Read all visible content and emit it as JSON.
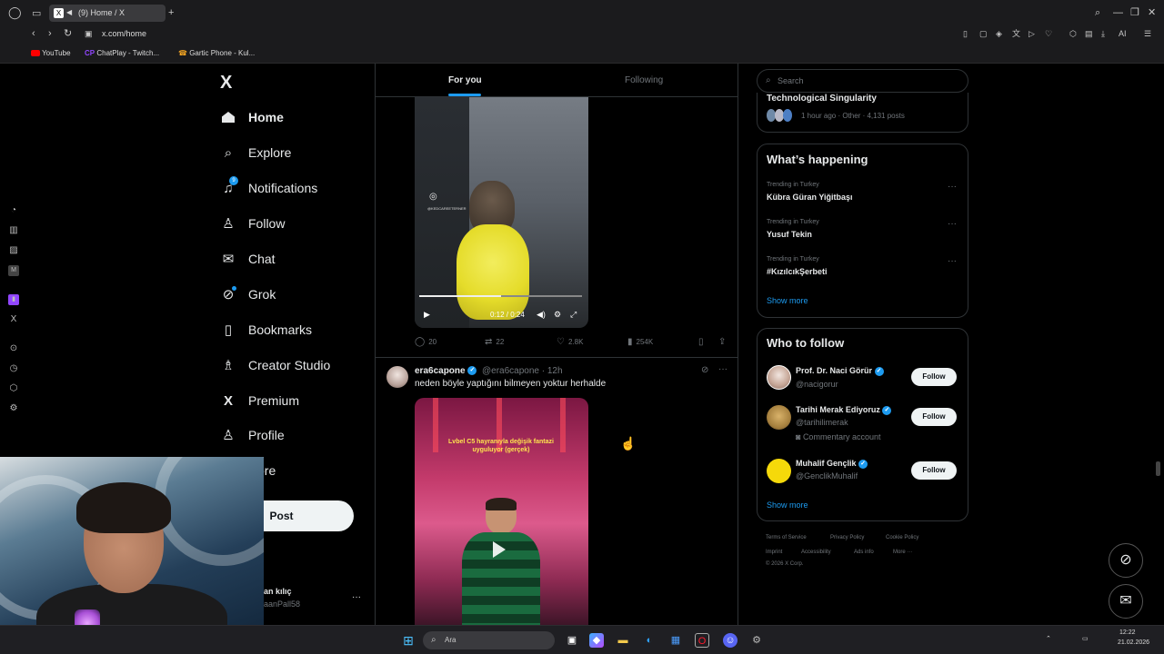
{
  "browser": {
    "tab_title": "(9) Home / X",
    "url": "x.com/home",
    "bookmarks": [
      {
        "label": "YouTube",
        "icon": "youtube-icon",
        "color": "#ff0000"
      },
      {
        "label": "ChatPlay - Twitch...",
        "icon": "chatplay-icon",
        "color": "#9146ff"
      },
      {
        "label": "Gartic Phone - Kul...",
        "icon": "gartic-icon",
        "color": "#f5a623"
      }
    ],
    "toolbar_right": {
      "ai_label": "AI"
    }
  },
  "nav": {
    "logo": "X",
    "items": [
      {
        "label": "Home",
        "icon": "home-icon",
        "glyph": "⌂",
        "active": true
      },
      {
        "label": "Explore",
        "icon": "search-icon",
        "glyph": "⌕"
      },
      {
        "label": "Notifications",
        "icon": "bell-icon",
        "glyph": "♪",
        "badge": "9"
      },
      {
        "label": "Follow",
        "icon": "person-plus-icon",
        "glyph": "+"
      },
      {
        "label": "Chat",
        "icon": "envelope-icon",
        "glyph": "✉"
      },
      {
        "label": "Grok",
        "icon": "grok-icon",
        "glyph": "⊘"
      },
      {
        "label": "Bookmarks",
        "icon": "bookmark-icon",
        "glyph": "▯"
      },
      {
        "label": "Creator Studio",
        "icon": "creator-studio-icon",
        "glyph": "♙"
      },
      {
        "label": "Premium",
        "icon": "x-premium-icon",
        "glyph": "X"
      },
      {
        "label": "Profile",
        "icon": "person-icon",
        "glyph": "♙"
      },
      {
        "label": "ore",
        "icon": "more-icon",
        "glyph": ""
      }
    ],
    "post_label": "Post",
    "account_name": "an kılıç",
    "account_handle": "aanPall58",
    "account_more": "···"
  },
  "feed": {
    "tabs": [
      "For you",
      "Following"
    ],
    "video1": {
      "time": "0:12 / 0:24",
      "watermark": "@KEDCAREETERNER",
      "progress": 0.5
    },
    "post1_actions": {
      "replies": "20",
      "reposts": "22",
      "likes": "2.8K",
      "views": "254K"
    },
    "post2": {
      "name": "era6capone",
      "handle": "@era6capone · 12h",
      "text": "neden böyle yaptığını bilmeyen yoktur herhalde",
      "video_caption": "Lvbel C5 hayranıyla değişik fantazi uyguluyor (gerçek)"
    }
  },
  "sidebar": {
    "search_placeholder": "Search",
    "top_trend": {
      "title": "Technological Singularity",
      "meta": "1 hour ago · Other · 4,131 posts"
    },
    "happening": {
      "title": "What’s happening",
      "trends": [
        {
          "category": "Trending in Turkey",
          "name": "Kübra Güran Yiğitbaşı"
        },
        {
          "category": "Trending in Turkey",
          "name": "Yusuf Tekin"
        },
        {
          "category": "Trending in Turkey",
          "name": "#KızılcıkŞerbeti"
        }
      ],
      "show_more": "Show more"
    },
    "who_to_follow": {
      "title": "Who to follow",
      "accounts": [
        {
          "name": "Prof. Dr. Naci Görür",
          "handle": "@nacigorur",
          "sub": ""
        },
        {
          "name": "Tarihi Merak Ediyoruz",
          "handle": "@tarihilimerak",
          "sub": "Commentary account"
        },
        {
          "name": "Muhalif Gençlik",
          "handle": "@GenclikMuhalif",
          "sub": ""
        }
      ],
      "follow_label": "Follow",
      "show_more": "Show more"
    },
    "footer": {
      "links": [
        "Terms of Service",
        "Privacy Policy",
        "Cookie Policy",
        "Imprint",
        "Accessibility",
        "Ads info",
        "More ···"
      ],
      "copyright": "© 2026 X Corp."
    }
  },
  "taskbar": {
    "search_placeholder": "Ara",
    "time": "12:22",
    "date": "21.02.2026"
  },
  "colors": {
    "accent": "#1d9bf0",
    "background": "#000000",
    "border": "#2f3336",
    "muted": "#71767b"
  }
}
